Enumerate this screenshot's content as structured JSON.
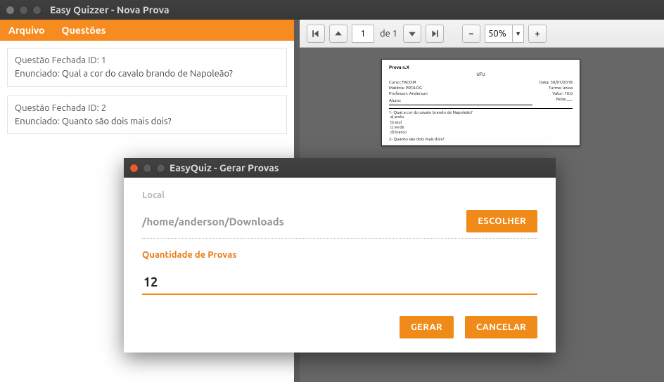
{
  "main_window": {
    "title": "Easy Quizzer - Nova Prova",
    "menu": {
      "arquivo": "Arquivo",
      "questoes": "Questões"
    },
    "questions": [
      {
        "id_line": "Questão Fechada ID: 1",
        "enunciado": "Enunciado: Qual a cor do cavalo brando de Napoleão?"
      },
      {
        "id_line": "Questão Fechada ID: 2",
        "enunciado": "Enunciado: Quanto são dois mais dois?"
      }
    ]
  },
  "pdf_toolbar": {
    "page_current": "1",
    "page_of_label": "de 1",
    "zoom_value": "50%"
  },
  "pdf_preview": {
    "prova_n": "Prova n.X",
    "ufu": "UFU",
    "curso": "Curso: FACOM",
    "materia": "Matéria: PROLOG",
    "professor": "Professor: Anderson",
    "aluno_label": "Aluno:",
    "data": "Data: 30/07/2018",
    "turma": "Turma: única",
    "valor": "Valor: 10.0",
    "nota": "Nota:___",
    "q1": "1- Qual a cor do cavalo brando de Napoleão?",
    "q1_alts": [
      "a) preto",
      "b) azul",
      "c) verde",
      "d) branco"
    ],
    "q2": "2- Quanto são dois mais dois?"
  },
  "modal": {
    "title": "EasyQuiz - Gerar Provas",
    "local_label": "Local",
    "local_path": "/home/anderson/Downloads",
    "escolher": "ESCOLHER",
    "qtd_label": "Quantidade de Provas",
    "qtd_value": "12",
    "gerar": "GERAR",
    "cancelar": "CANCELAR"
  }
}
